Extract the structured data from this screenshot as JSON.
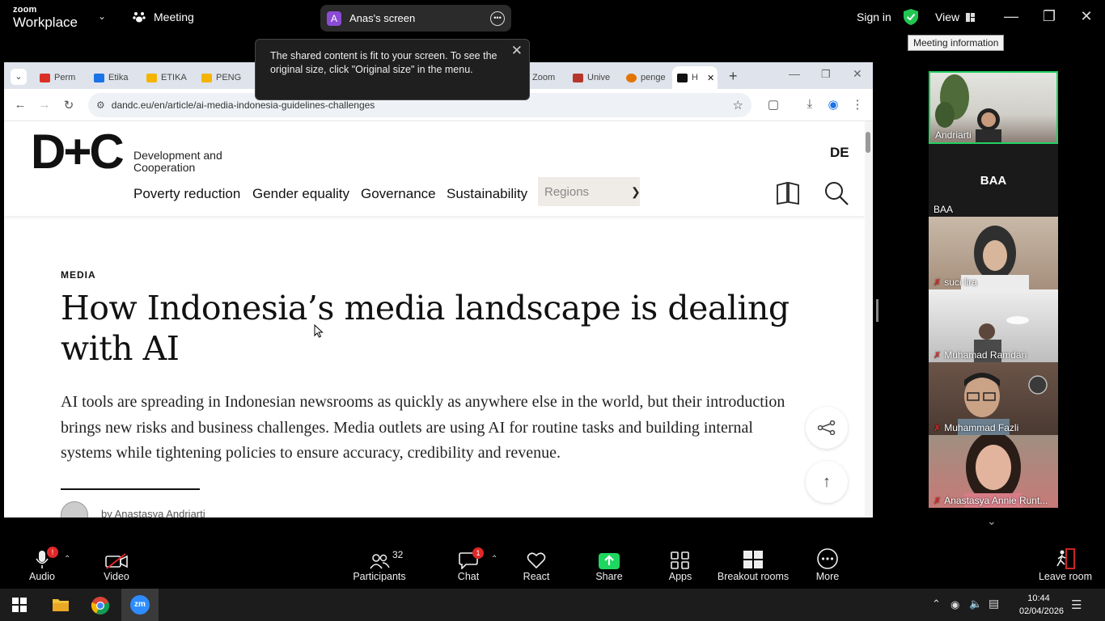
{
  "zoom": {
    "brand_top": "zoom",
    "brand_name": "Workplace",
    "meeting_label": "Meeting",
    "share_owner_initial": "A",
    "share_owner_label": "Anas's screen",
    "sign_in": "Sign in",
    "view": "View",
    "tooltip": "Meeting information",
    "toast_text": "The shared content is fit to your screen. To see the original size, click \"Original size\" in the menu."
  },
  "browser": {
    "tabs": [
      {
        "label": "Perm",
        "color": "#d93025"
      },
      {
        "label": "Etika",
        "color": "#1a73e8"
      },
      {
        "label": "ETIKA",
        "color": "#f4b400"
      },
      {
        "label": "PENG",
        "color": "#f4b400"
      },
      {
        "label": "Zoom",
        "color": "#1a73e8"
      },
      {
        "label": "Unive",
        "color": "#b7352b"
      },
      {
        "label": "penge",
        "color": "#e37400"
      },
      {
        "label": "H",
        "color": "#111111"
      }
    ],
    "url": "dandc.eu/en/article/ai-media-indonesia-guidelines-challenges"
  },
  "site": {
    "logo": "D+C",
    "logo_sub": "Development and Cooperation",
    "lang": "DE",
    "nav": [
      "Poverty reduction",
      "Gender equality",
      "Governance",
      "Sustainability"
    ],
    "regions": "Regions",
    "kicker": "MEDIA",
    "headline": "How Indonesia’s media landscape is dealing with AI",
    "lede": "AI tools are spreading in Indonesian newsrooms as quickly as anywhere else in the world, but their introduction brings new risks and business challenges. Media outlets are using AI for routine tasks and building internal systems while tightening policies to ensure accuracy, credibility and revenue.",
    "byline": "by Anastasya Andriarti"
  },
  "participants_panel": [
    {
      "name": "Andriarti",
      "muted": false
    },
    {
      "name": "BAA",
      "display": "BAA",
      "muted": false
    },
    {
      "name": "suci lira",
      "muted": true
    },
    {
      "name": "Muhamad Ramdan",
      "muted": true
    },
    {
      "name": "Muhammad Fazli",
      "muted": true
    },
    {
      "name": "Anastasya Annie Runt...",
      "muted": true
    }
  ],
  "toolbar": {
    "audio": "Audio",
    "audio_badge": "!",
    "video": "Video",
    "participants": "Participants",
    "participants_count": "32",
    "chat": "Chat",
    "chat_badge": "1",
    "react": "React",
    "share": "Share",
    "apps": "Apps",
    "breakout": "Breakout rooms",
    "more": "More",
    "leave": "Leave room"
  },
  "taskbar": {
    "time": "10:44",
    "date": "02/04/2026"
  },
  "colors": {
    "share_green": "#1ed760",
    "spotlight_green": "#23d160",
    "accent_red": "#e02828"
  }
}
